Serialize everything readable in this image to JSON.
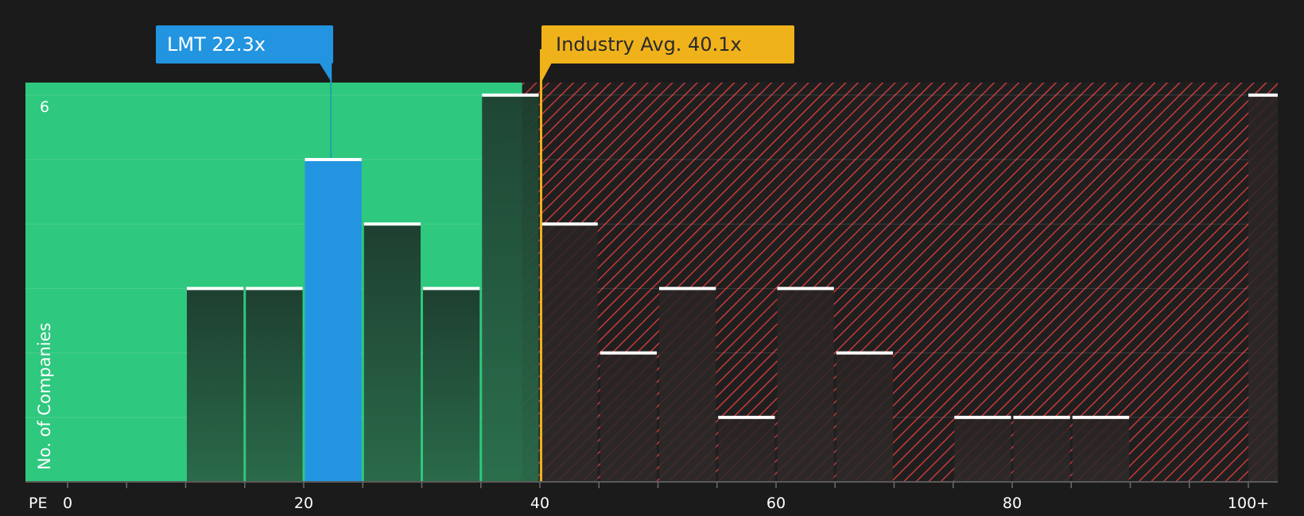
{
  "chart_data": {
    "type": "bar",
    "x_axis_label": "PE",
    "y_axis_label": "No. of Companies",
    "x_ticks": [
      "0",
      "20",
      "40",
      "60",
      "80",
      "100+"
    ],
    "y_tick_labels": [
      "6"
    ],
    "bin_width": 5,
    "bins": [
      {
        "start": 0,
        "count": 0
      },
      {
        "start": 5,
        "count": 0
      },
      {
        "start": 10,
        "count": 3
      },
      {
        "start": 15,
        "count": 3
      },
      {
        "start": 20,
        "count": 5,
        "highlight": true
      },
      {
        "start": 25,
        "count": 4
      },
      {
        "start": 30,
        "count": 3
      },
      {
        "start": 35,
        "count": 6
      },
      {
        "start": 40,
        "count": 4
      },
      {
        "start": 45,
        "count": 2
      },
      {
        "start": 50,
        "count": 3
      },
      {
        "start": 55,
        "count": 1
      },
      {
        "start": 60,
        "count": 3
      },
      {
        "start": 65,
        "count": 2
      },
      {
        "start": 70,
        "count": 0
      },
      {
        "start": 75,
        "count": 1
      },
      {
        "start": 80,
        "count": 1
      },
      {
        "start": 85,
        "count": 1
      },
      {
        "start": 90,
        "count": 0
      },
      {
        "start": 95,
        "count": 0
      },
      {
        "start": 100,
        "count": 6
      }
    ],
    "ylim": [
      0,
      6.2
    ],
    "grid": true,
    "company": {
      "label": "LMT 22.3x",
      "value": 22.3
    },
    "industry_avg": {
      "label": "Industry Avg. 40.1x",
      "value": 40.1
    },
    "fair_zone_end": 38.5,
    "colors": {
      "background": "#1b1b1b",
      "green_zone": "#2ec87e",
      "red_hatch": "#c8393b",
      "highlight_bar": "#2394e0",
      "bar_dark": "#1f3e2f",
      "industry": "#f0b21b",
      "white": "#ffffff"
    }
  }
}
